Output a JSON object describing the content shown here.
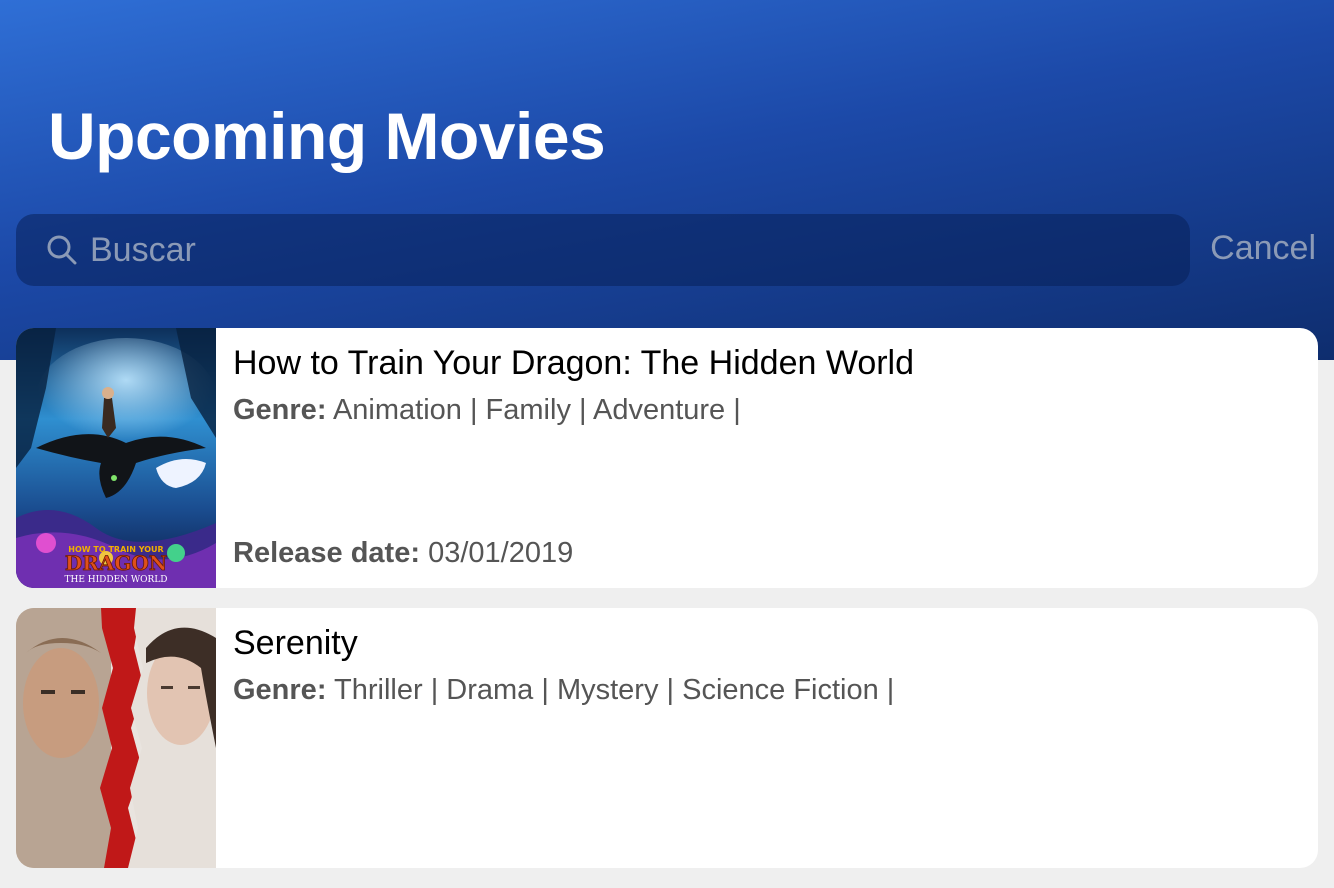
{
  "header": {
    "title": "Upcoming Movies",
    "search_placeholder": "Buscar",
    "cancel_label": "Cancel"
  },
  "icons": {
    "search": "search-icon"
  },
  "colors": {
    "header_gradient_start": "#2f6fd6",
    "header_gradient_end": "#0e2d6e",
    "background": "#efefef",
    "card": "#ffffff"
  },
  "labels": {
    "genre": "Genre:",
    "release_date": "Release date:"
  },
  "movies": [
    {
      "title": "How to Train Your Dragon: The Hidden World",
      "genres": "Animation | Family | Adventure |",
      "release_date": "03/01/2019",
      "poster_text": "HOW TO TRAIN YOUR",
      "poster_title": "DRAGON",
      "poster_subtitle": "THE HIDDEN WORLD"
    },
    {
      "title": "Serenity",
      "genres": "Thriller | Drama | Mystery | Science Fiction |"
    }
  ]
}
